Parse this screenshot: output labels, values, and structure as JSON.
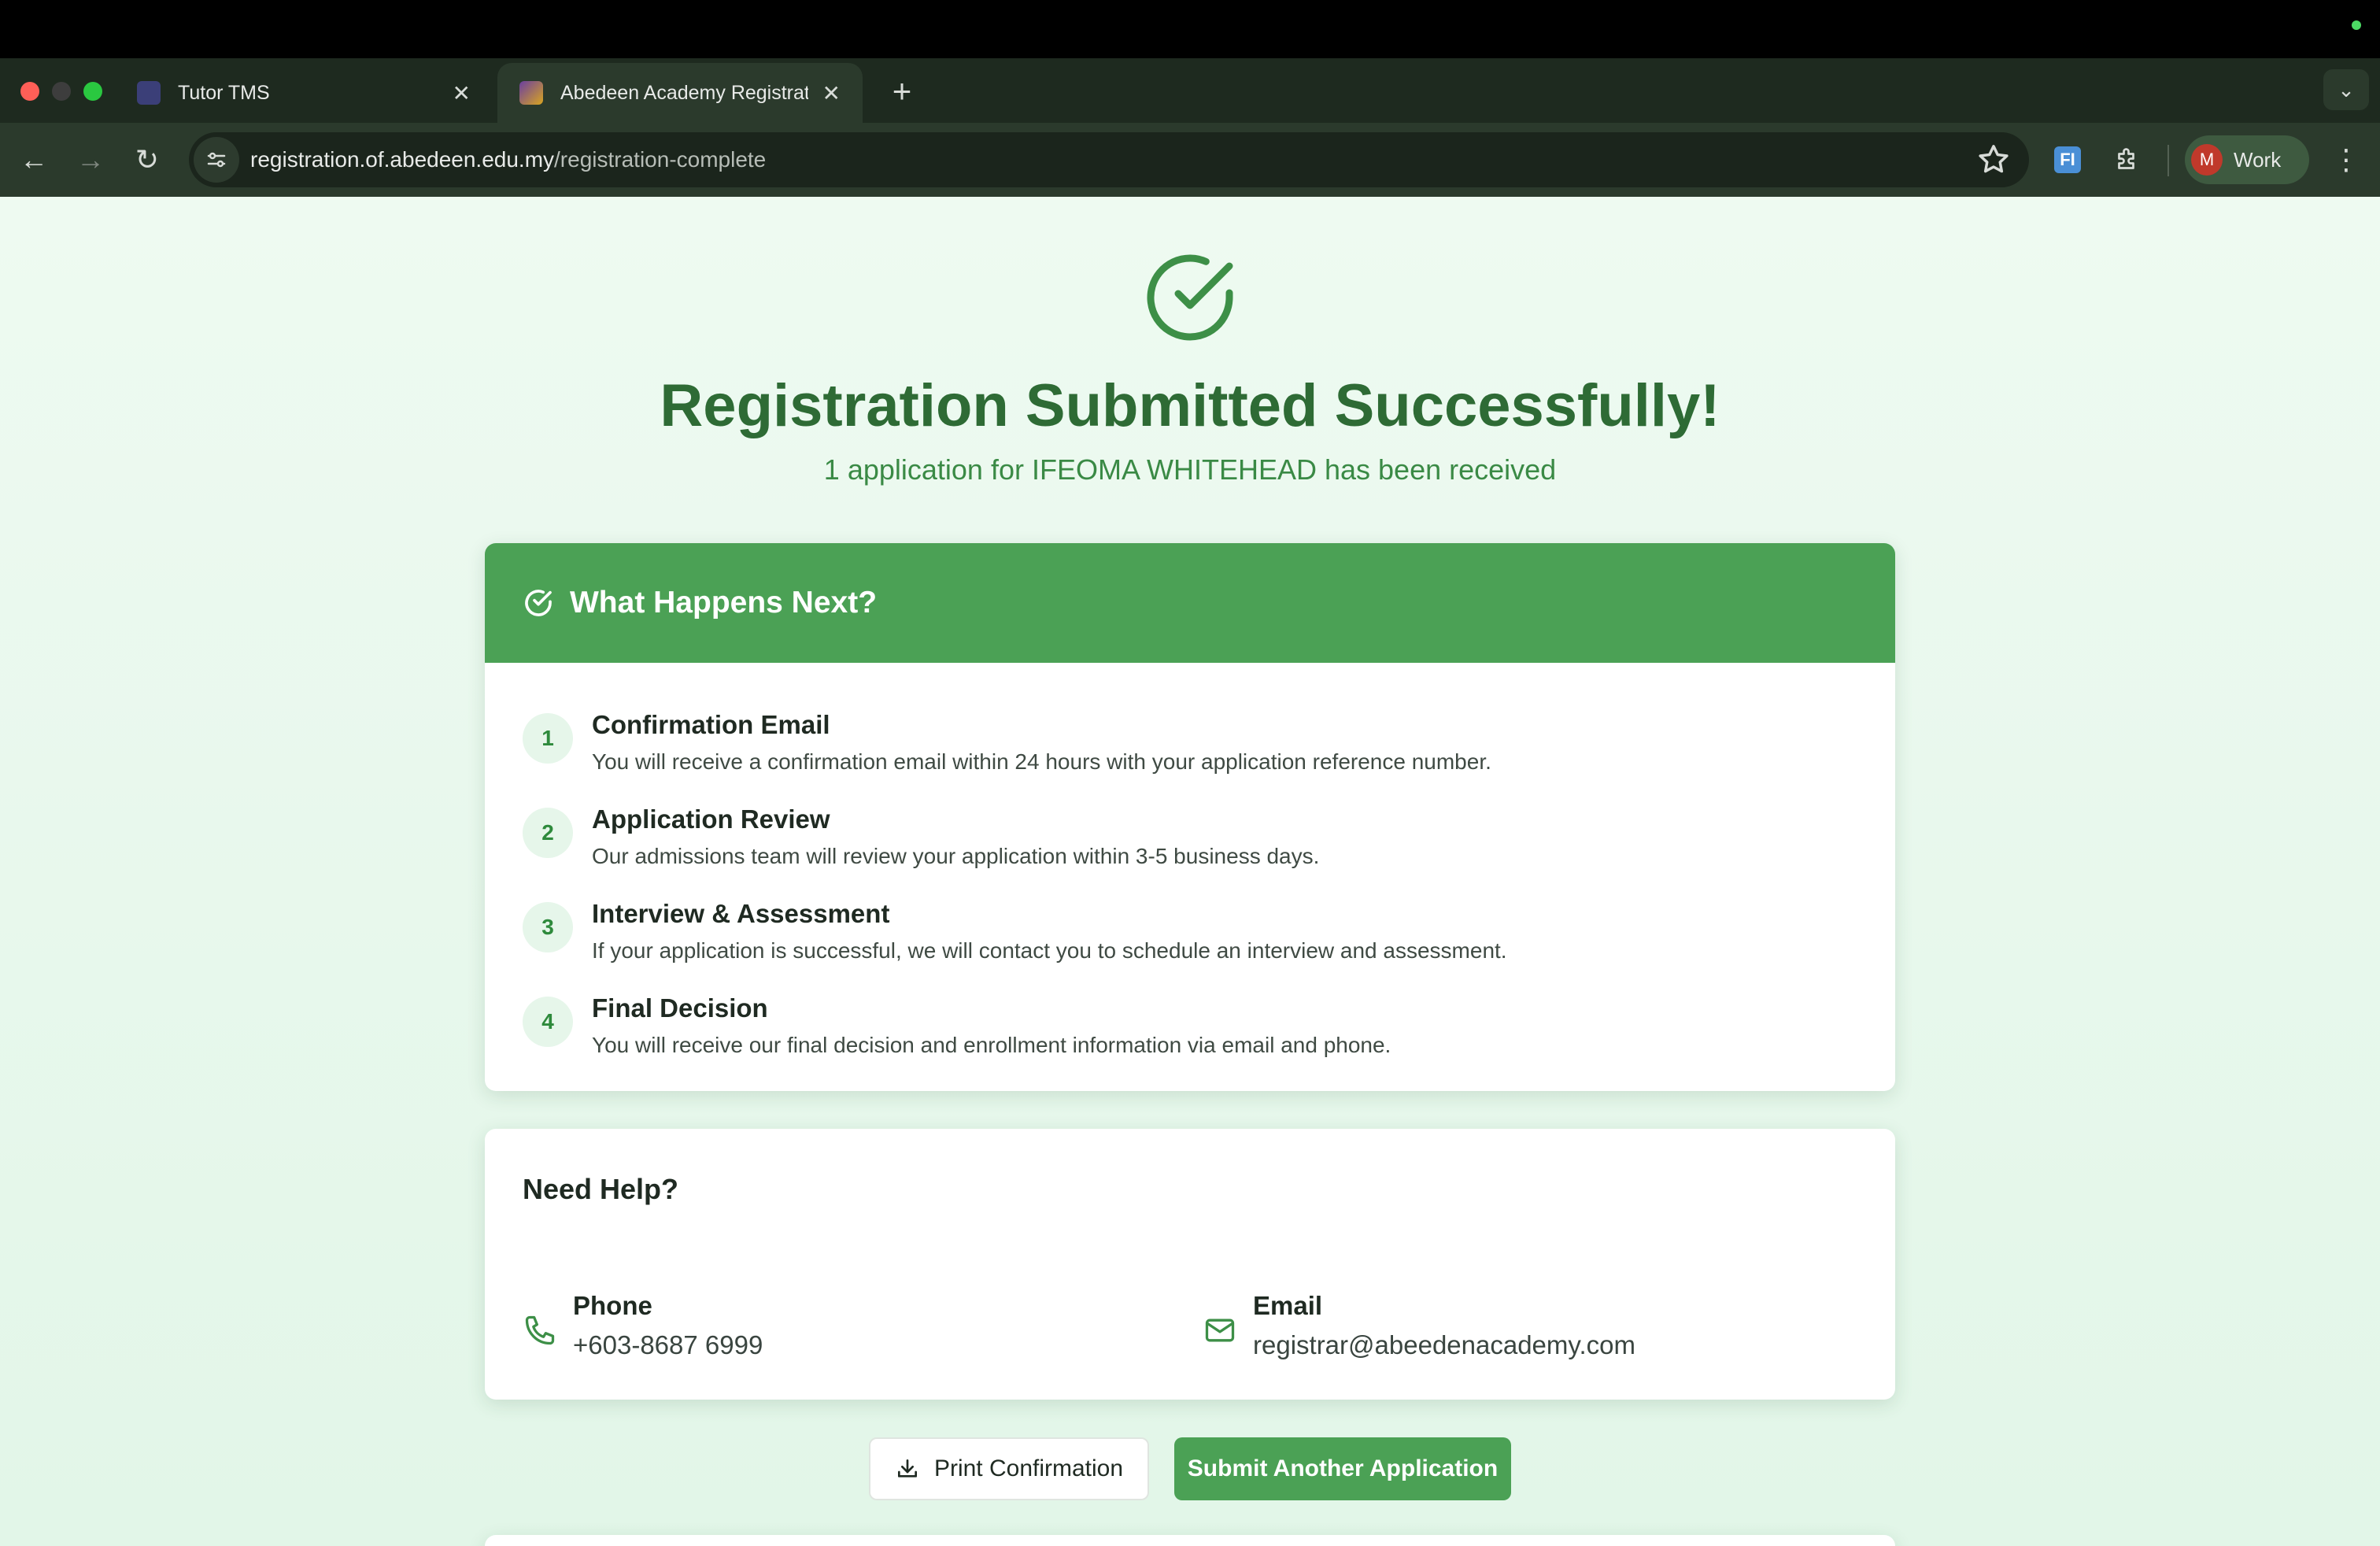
{
  "browser": {
    "tabs": [
      {
        "title": "Tutor TMS",
        "active": false
      },
      {
        "title": "Abedeen Academy Registratio",
        "active": true
      }
    ],
    "url_host": "registration.of.abedeen.edu.my",
    "url_path": "/registration-complete",
    "profile_initial": "M",
    "profile_name": "Work",
    "extension_badge": "FI"
  },
  "page": {
    "title": "Registration Submitted Successfully!",
    "subtitle": "1 application for IFEOMA WHITEHEAD has been received",
    "next": {
      "heading": "What Happens Next?",
      "steps": [
        {
          "num": "1",
          "title": "Confirmation Email",
          "desc": "You will receive a confirmation email within 24 hours with your application reference number."
        },
        {
          "num": "2",
          "title": "Application Review",
          "desc": "Our admissions team will review your application within 3-5 business days."
        },
        {
          "num": "3",
          "title": "Interview & Assessment",
          "desc": "If your application is successful, we will contact you to schedule an interview and assessment."
        },
        {
          "num": "4",
          "title": "Final Decision",
          "desc": "You will receive our final decision and enrollment information via email and phone."
        }
      ]
    },
    "help": {
      "heading": "Need Help?",
      "phone_label": "Phone",
      "phone_value": "+603-8687 6999",
      "email_label": "Email",
      "email_value": "registrar@abeedenacademy.com"
    },
    "buttons": {
      "print": "Print Confirmation",
      "submit_another": "Submit Another Application"
    }
  },
  "colors": {
    "accent": "#4ba155",
    "title_green": "#2e6b35",
    "page_bg": "#eefaf1"
  }
}
